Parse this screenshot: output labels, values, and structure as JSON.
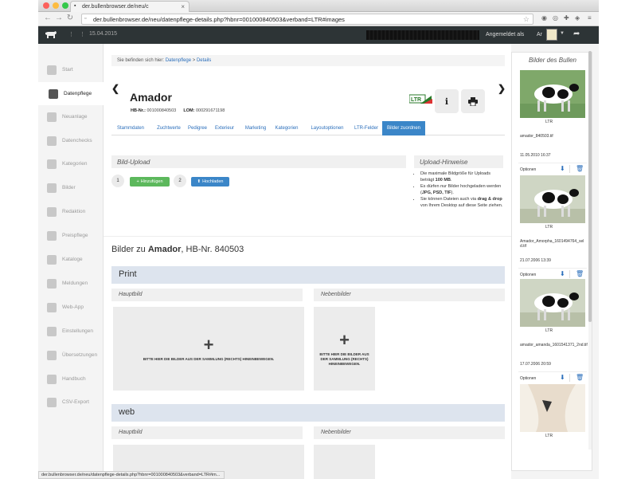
{
  "browser": {
    "tab_title": "der.bullenbrowser.de/neu/c",
    "url": "der.bullenbrowser.de/neu/datenpflege-details.php?hbnr=001000840503&verband=LTR#images",
    "status_url": "der.bullenbrowser.de/neu/datenpflege-details.php?hbnr=001000840503&verband=LTR#im..."
  },
  "header": {
    "date_text": "15.04.2015",
    "logged_in_label": "Angemeldet als",
    "user_initials": "Ar"
  },
  "sidebar": {
    "items": [
      {
        "label": "Start",
        "icon": "home-icon"
      },
      {
        "label": "Datenpflege",
        "icon": "edit-icon"
      },
      {
        "label": "Neuanlage",
        "icon": "plus-icon"
      },
      {
        "label": "Datenchecks",
        "icon": "wand-icon"
      },
      {
        "label": "Kategorien",
        "icon": "list-icon"
      },
      {
        "label": "Bilder",
        "icon": "image-icon"
      },
      {
        "label": "Redaktion",
        "icon": "image-icon"
      },
      {
        "label": "Preispflege",
        "icon": "cart-icon"
      },
      {
        "label": "Kataloge",
        "icon": "book-icon"
      },
      {
        "label": "Meldungen",
        "icon": "envelope-icon"
      },
      {
        "label": "Web-App",
        "icon": "phone-icon"
      },
      {
        "label": "Einstellungen",
        "icon": "cogs-icon"
      },
      {
        "label": "Übersetzungen",
        "icon": "globe-icon"
      },
      {
        "label": "Handbuch",
        "icon": "info-icon"
      },
      {
        "label": "CSV-Export",
        "icon": "export-icon"
      }
    ]
  },
  "breadcrumb": {
    "prefix": "Sie befinden sich hier:",
    "link1": "Datenpflege",
    "sep": ">",
    "link2": "Details"
  },
  "bull": {
    "name": "Amador",
    "hb_label": "HB-Nr.:",
    "hb_value": "001000840503",
    "lom_label": "LOM:",
    "lom_value": "000291671198",
    "logo_text": "LTR"
  },
  "tabs": [
    "Stammdaten",
    "Zuchtwerte",
    "Pedigree",
    "Exterieur",
    "Marketing",
    "Kategorien",
    "Layoutoptionen",
    "LTR-Felder",
    "Bilder zuordnen"
  ],
  "upload": {
    "title": "Bild-Upload",
    "step1": "1",
    "add_label": "Hinzufügen",
    "step2": "2",
    "upload_label": "Hochladen"
  },
  "hints": {
    "title": "Upload-Hinweise",
    "h1_pre": "Die maximale Bildgröße für Uploads beträgt",
    "h1_bold": "100 MB",
    "h1_post": ".",
    "h2_pre": "Es dürfen nur Bilder hochgeladen werden (",
    "h2_bold": "JPG, PSD, TIF",
    "h2_post": ").",
    "h3_pre": "Sie können Dateien auch via",
    "h3_bold": "drag & drop",
    "h3_post": "von Ihrem Desktop auf diese Seite ziehen."
  },
  "images_section": {
    "title_pre": "Bilder zu",
    "title_bold": "Amador",
    "title_post": ", HB-Nr. 840503",
    "sections": [
      {
        "name": "Print",
        "main_label": "Hauptbild",
        "side_label": "Nebenbilder"
      },
      {
        "name": "web",
        "main_label": "Hauptbild",
        "side_label": "Nebenbilder"
      }
    ],
    "drop_text": "BITTE HIER DIE BILDER AUS DER SAMMLUNG (RECHTS) HINEINBEWEGEN."
  },
  "right_panel": {
    "title": "Bilder des Bullen",
    "items": [
      {
        "tag": "LTR",
        "filename": "amador_840503.tif",
        "date": "11.05.2010 16:37",
        "options": "Optionen"
      },
      {
        "tag": "LTR",
        "filename": "Amador_Amorpha_1601494764_sel d.tif",
        "date": "21.07.2006 13:39",
        "options": "Optionen"
      },
      {
        "tag": "LTR",
        "filename": "amador_amanda_1601541371_2nd.tif",
        "date": "17.07.2006 20:59",
        "options": "Optionen"
      },
      {
        "tag": "LTR",
        "filename": "",
        "date": "",
        "options": ""
      }
    ]
  },
  "colors": {
    "accent": "#3b86c8",
    "green": "#5cb85c",
    "header_bg": "#2d3436"
  }
}
